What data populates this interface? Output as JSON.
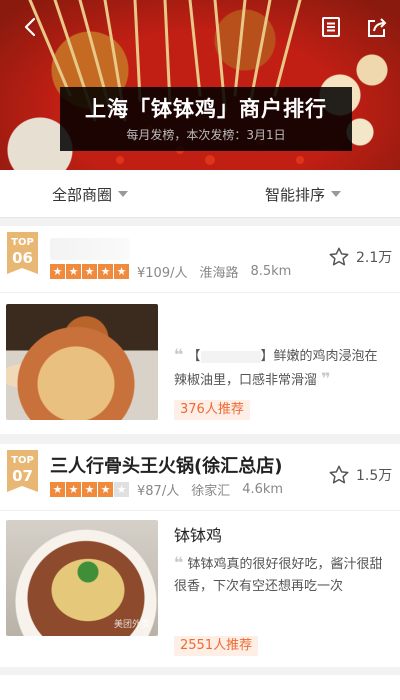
{
  "hero": {
    "title": "上海「钵钵鸡」商户排行",
    "subtitle_prefix": "每月发榜，本次发榜：",
    "release_date": "3月1日"
  },
  "filters": {
    "area_label": "全部商圈",
    "sort_label": "智能排序"
  },
  "icons": {
    "back": "chevron-left-icon",
    "list": "list-icon",
    "share": "share-icon",
    "favorite": "star-outline-icon",
    "rating_star": "star-icon"
  },
  "colors": {
    "accent": "#f06a33",
    "badge": "#e9b774",
    "star_on": "#f08a3c"
  },
  "shops": [
    {
      "badge_top": "TOP",
      "rank": "06",
      "name": "",
      "rating_stars": 5,
      "price": "¥109/人",
      "area": "淮海路",
      "distance": "8.5km",
      "favorites": "2.1万",
      "dish_name": "",
      "review_open": "【",
      "review_close": "】鲜嫩的鸡肉浸泡在辣椒油里，口感非常滑溜",
      "recommend": "376人推荐"
    },
    {
      "badge_top": "TOP",
      "rank": "07",
      "name": "三人行骨头王火锅(徐汇总店)",
      "rating_stars": 4,
      "price": "¥87/人",
      "area": "徐家汇",
      "distance": "4.6km",
      "favorites": "1.5万",
      "dish_name": "钵钵鸡",
      "review": "钵钵鸡真的很好很好吃，酱汁很甜很香，下次有空还想再吃一次",
      "recommend": "2551人推荐",
      "watermark": "美团外卖"
    }
  ]
}
